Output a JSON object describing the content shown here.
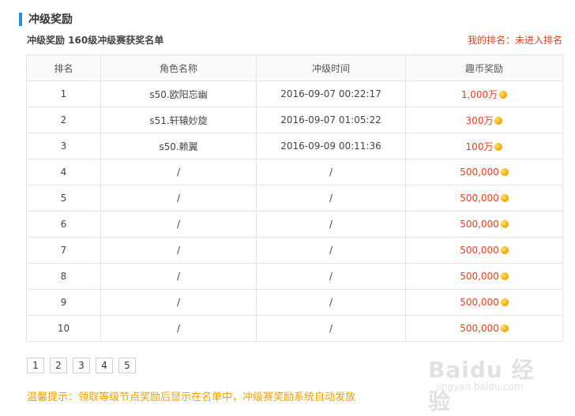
{
  "section": {
    "title": "冲级奖励"
  },
  "subtitle": "冲级奖励 160级冲级赛获奖名单",
  "my_rank": "我的排名：未进入排名",
  "table": {
    "headers": [
      "排名",
      "角色名称",
      "冲级时间",
      "趣币奖励"
    ],
    "rows": [
      {
        "rank": "1",
        "name": "s50.欧阳忘幽",
        "time": "2016-09-07 00:22:17",
        "reward": "1,000万"
      },
      {
        "rank": "2",
        "name": "s51.轩辕妙旋",
        "time": "2016-09-07 01:05:22",
        "reward": "300万"
      },
      {
        "rank": "3",
        "name": "s50.赖翼",
        "time": "2016-09-09 00:11:36",
        "reward": "100万"
      },
      {
        "rank": "4",
        "name": "/",
        "time": "/",
        "reward": "500,000"
      },
      {
        "rank": "5",
        "name": "/",
        "time": "/",
        "reward": "500,000"
      },
      {
        "rank": "6",
        "name": "/",
        "time": "/",
        "reward": "500,000"
      },
      {
        "rank": "7",
        "name": "/",
        "time": "/",
        "reward": "500,000"
      },
      {
        "rank": "8",
        "name": "/",
        "time": "/",
        "reward": "500,000"
      },
      {
        "rank": "9",
        "name": "/",
        "time": "/",
        "reward": "500,000"
      },
      {
        "rank": "10",
        "name": "/",
        "time": "/",
        "reward": "500,000"
      }
    ]
  },
  "pager": [
    "1",
    "2",
    "3",
    "4",
    "5"
  ],
  "tip": "温馨提示：领取等级节点奖励后显示在名单中，冲级赛奖励系统自动发放",
  "watermark": {
    "logo": "Baidu 经验",
    "url": "jingyan.baidu.com"
  },
  "colors": {
    "accent": "#2a8fe0",
    "reward": "#e8411f",
    "tip": "#f5a000"
  }
}
